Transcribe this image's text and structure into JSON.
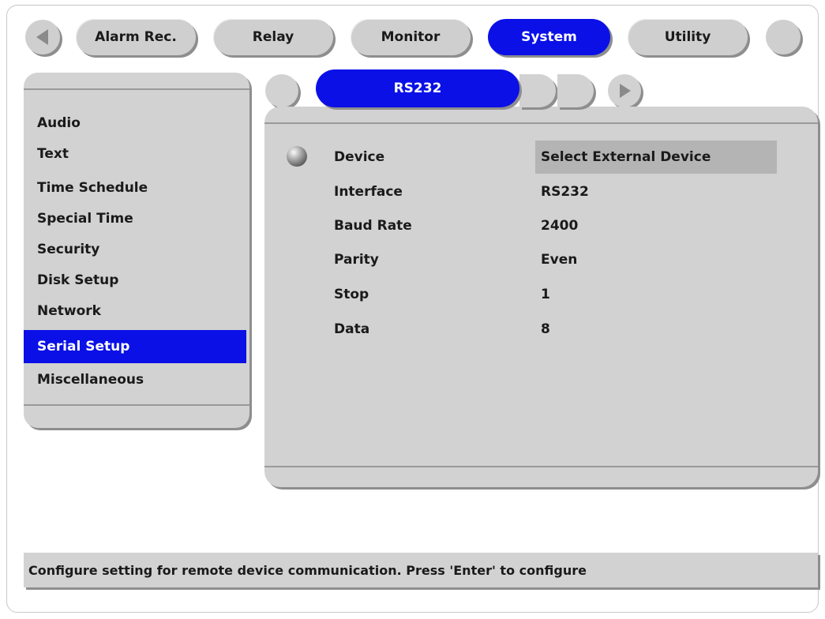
{
  "nav": {
    "back_icon": "triangle-left-icon",
    "tabs": [
      {
        "label": "Alarm Rec."
      },
      {
        "label": "Relay"
      },
      {
        "label": "Monitor"
      },
      {
        "label": "System"
      },
      {
        "label": "Utility"
      }
    ],
    "active_tab": "System"
  },
  "sidebar": {
    "items": [
      {
        "label": "Audio"
      },
      {
        "label": "Text"
      },
      {
        "label": "Time Schedule"
      },
      {
        "label": "Special Time"
      },
      {
        "label": "Security"
      },
      {
        "label": "Disk Setup"
      },
      {
        "label": "Network"
      },
      {
        "label": "Serial Setup"
      },
      {
        "label": "Miscellaneous"
      }
    ],
    "selected": "Serial Setup"
  },
  "subtabs": {
    "active_label": "RS232",
    "next_icon": "triangle-right-icon"
  },
  "settings": [
    {
      "label": "Device",
      "value": "Select External Device"
    },
    {
      "label": "Interface",
      "value": "RS232"
    },
    {
      "label": "Baud Rate",
      "value": "2400"
    },
    {
      "label": "Parity",
      "value": "Even"
    },
    {
      "label": "Stop",
      "value": "1"
    },
    {
      "label": "Data",
      "value": "8"
    }
  ],
  "status_text": "Configure setting for remote device communication. Press 'Enter' to configure",
  "colors": {
    "accent": "#0a10e6",
    "panel": "#d2d2d2",
    "shadow": "#8e8e8e"
  }
}
